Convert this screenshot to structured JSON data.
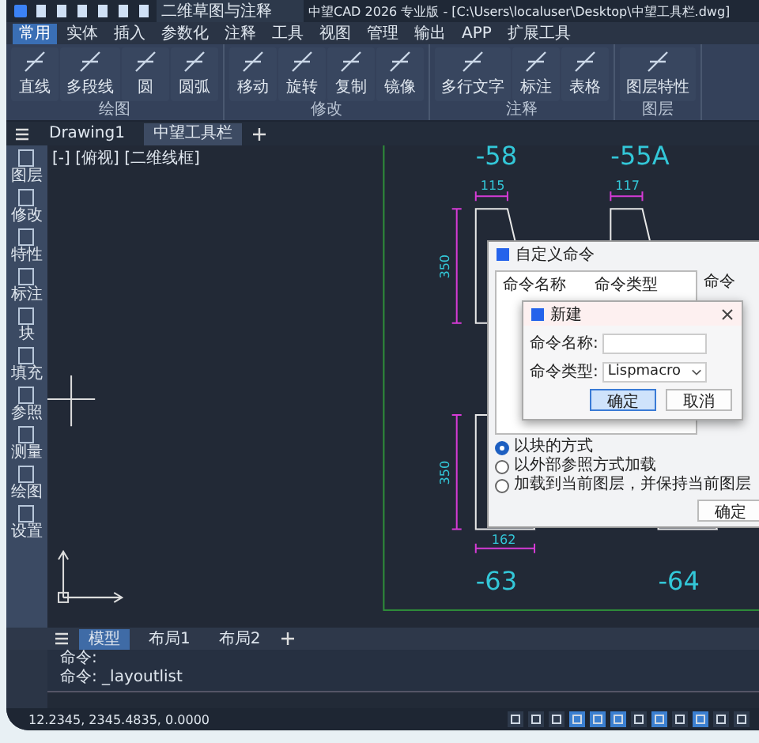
{
  "title_bar": {
    "workspace": "二维草图与注释",
    "title": "中望CAD 2026 专业版 - [C:\\Users\\localuser\\Desktop\\中望工具栏.dwg]"
  },
  "menu_tabs": [
    {
      "label": "常用",
      "selected": true
    },
    {
      "label": "实体",
      "selected": false
    },
    {
      "label": "插入",
      "selected": false
    },
    {
      "label": "参数化",
      "selected": false
    },
    {
      "label": "注释",
      "selected": false
    },
    {
      "label": "工具",
      "selected": false
    },
    {
      "label": "视图",
      "selected": false
    },
    {
      "label": "管理",
      "selected": false
    },
    {
      "label": "输出",
      "selected": false
    },
    {
      "label": "APP",
      "selected": false
    },
    {
      "label": "扩展工具",
      "selected": false
    }
  ],
  "ribbon": [
    {
      "label": "绘图",
      "tools": [
        "直线",
        "多段线",
        "圆",
        "圆弧"
      ]
    },
    {
      "label": "修改",
      "tools": [
        "移动",
        "旋转",
        "复制",
        "镜像"
      ]
    },
    {
      "label": "注释",
      "tools": [
        "多行文字",
        "标注",
        "表格"
      ]
    },
    {
      "label": "图层",
      "tools": [
        "图层特性"
      ]
    }
  ],
  "doc_tabs": [
    {
      "label": "Drawing1",
      "selected": false
    },
    {
      "label": "中望工具栏",
      "selected": true
    }
  ],
  "viewport_label": "[-] [俯视] [二维线框]",
  "side_tools": [
    "图层",
    "修改",
    "特性",
    "标注",
    "块",
    "填充",
    "参照",
    "测量",
    "绘图",
    "设置"
  ],
  "parts": [
    {
      "label": "-58",
      "dims": [
        {
          "kind": "top",
          "text": "115"
        },
        {
          "kind": "side",
          "text": "350"
        }
      ]
    },
    {
      "label": "-55A",
      "dims": [
        {
          "kind": "top",
          "text": "117"
        }
      ]
    },
    {
      "label": "-63",
      "dims": [
        {
          "kind": "side",
          "text": "350"
        },
        {
          "kind": "bottom",
          "text": "162"
        }
      ]
    },
    {
      "label": "-64"
    }
  ],
  "dialog": {
    "title": "自定义命令",
    "columns": [
      "命令名称",
      "命令类型"
    ],
    "side_labels": [
      "命令"
    ],
    "radios": [
      {
        "label": "以块的方式",
        "selected": true
      },
      {
        "label": "以外部参照方式加载",
        "selected": false
      },
      {
        "label": "加载到当前图层，并保持当前图层",
        "selected": false
      }
    ],
    "buttons": [
      "确定"
    ]
  },
  "new_dialog": {
    "title": "新建",
    "fields": [
      {
        "label": "命令名称:",
        "kind": "text"
      },
      {
        "label": "命令类型:",
        "kind": "select",
        "value": "Lispmacro"
      }
    ],
    "buttons": [
      {
        "label": "确定",
        "selected": true
      },
      {
        "label": "取消",
        "selected": false
      }
    ]
  },
  "layout_tabs": [
    {
      "label": "模型",
      "selected": true
    },
    {
      "label": "布局1",
      "selected": false
    },
    {
      "label": "布局2",
      "selected": false
    }
  ],
  "command_lines": [
    "命令:",
    "命令: _layoutlist"
  ],
  "status_bar": {
    "coordinates": "12.2345, 2345.4835, 0.0000",
    "toggles": [
      {
        "on": false
      },
      {
        "on": false
      },
      {
        "on": false
      },
      {
        "on": true
      },
      {
        "on": true
      },
      {
        "on": true
      },
      {
        "on": false
      },
      {
        "on": true
      },
      {
        "on": false
      },
      {
        "on": true
      },
      {
        "on": false
      },
      {
        "on": false
      }
    ]
  }
}
